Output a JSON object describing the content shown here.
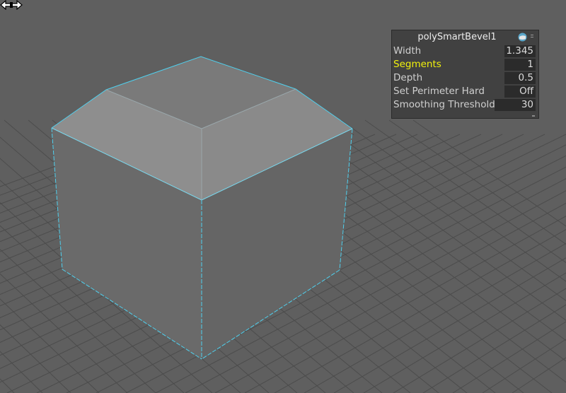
{
  "hud": {
    "title": "polySmartBevel1",
    "rows": [
      {
        "label": "Width",
        "value": "1.345",
        "highlighted": false
      },
      {
        "label": "Segments",
        "value": "1",
        "highlighted": true
      },
      {
        "label": "Depth",
        "value": "0.5",
        "highlighted": false
      },
      {
        "label": "Set Perimeter Hard",
        "value": "Off",
        "highlighted": false
      },
      {
        "label": "Smoothing Threshold",
        "value": "30",
        "highlighted": false
      }
    ]
  },
  "icons": {
    "settings": "globe-icon",
    "menu": "menu-dots-icon",
    "cursor": "horizontal-resize-cursor-icon"
  },
  "colors": {
    "viewport_background": "#5f5f5f",
    "grid_line": "#4a4a4a",
    "selection_edge": "#4fd0ee",
    "label_highlight": "#f2f20c"
  }
}
